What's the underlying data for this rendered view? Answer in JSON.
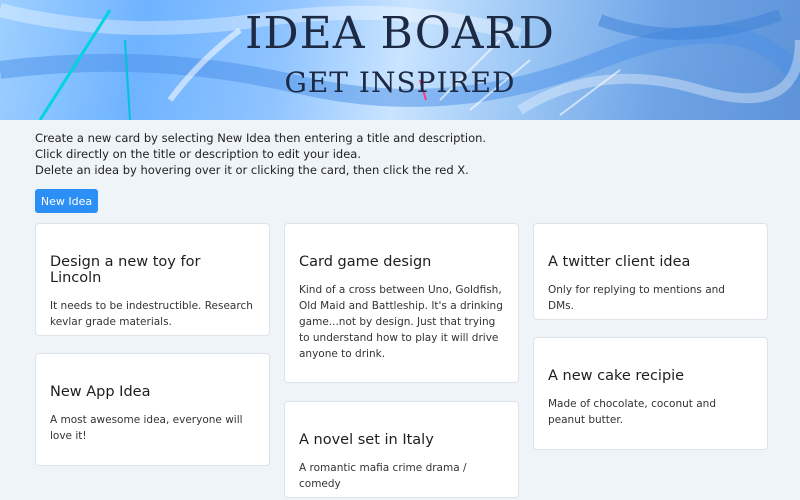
{
  "header": {
    "title": "IDEA BOARD",
    "subtitle": "GET INSPIRED"
  },
  "instructions": [
    "Create a new card by selecting New Idea then entering a title and description.",
    "Click directly on the title or description to edit your idea.",
    "Delete an idea by hovering over it or clicking the card, then click the red X."
  ],
  "toolbar": {
    "new_idea_label": "New Idea"
  },
  "cards": [
    {
      "title": "Design a new toy for Lincoln",
      "description": "It needs to be indestructible. Research kevlar grade materials."
    },
    {
      "title": "New App Idea",
      "description": "A most awesome idea, everyone will love it!"
    },
    {
      "title": "Card game design",
      "description": "Kind of a cross between Uno, Goldfish, Old Maid and Battleship. It's a drinking game...not by design. Just that trying to understand how to play it will drive anyone to drink."
    },
    {
      "title": "A novel set in Italy",
      "description": "A romantic mafia crime drama / comedy"
    },
    {
      "title": "A twitter client idea",
      "description": "Only for replying to mentions and DMs."
    },
    {
      "title": "A new cake recipie",
      "description": "Made of chocolate, coconut and peanut butter."
    }
  ],
  "colors": {
    "button": "#2b8ff5",
    "background": "#eef4f7",
    "card": "#ffffff",
    "heading": "#1d2a44"
  }
}
